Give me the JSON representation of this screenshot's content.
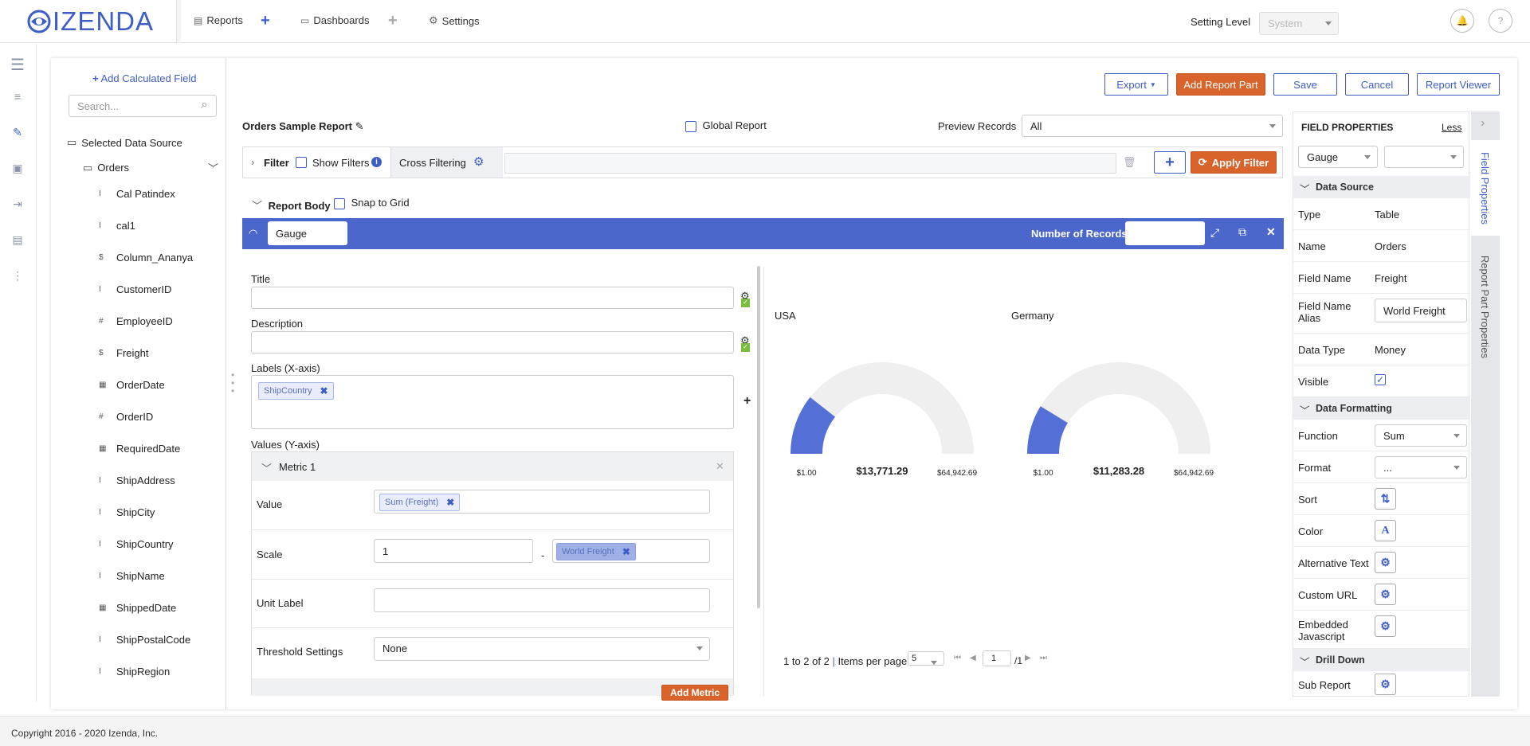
{
  "brand": {
    "logo_text": "IZENDA",
    "brand_color": "#3f5ec4"
  },
  "topnav": {
    "reports": "Reports",
    "dashboards": "Dashboards",
    "settings": "Settings"
  },
  "setting_level": {
    "label": "Setting Level",
    "value": "System"
  },
  "fields": {
    "add_calculated": "Add Calculated Field",
    "search_placeholder": "Search...",
    "selected_source": "Selected Data Source",
    "table": "Orders",
    "items": [
      {
        "name": "Cal Patindex",
        "icon": "text-type-icon",
        "glyph": "I"
      },
      {
        "name": "cal1",
        "icon": "text-type-icon",
        "glyph": "I"
      },
      {
        "name": "Column_Ananya",
        "icon": "money-type-icon",
        "glyph": "$"
      },
      {
        "name": "CustomerID",
        "icon": "text-type-icon",
        "glyph": "I"
      },
      {
        "name": "EmployeeID",
        "icon": "number-type-icon",
        "glyph": "#"
      },
      {
        "name": "Freight",
        "icon": "money-type-icon",
        "glyph": "$"
      },
      {
        "name": "OrderDate",
        "icon": "date-type-icon",
        "glyph": "▦"
      },
      {
        "name": "OrderID",
        "icon": "number-type-icon",
        "glyph": "#"
      },
      {
        "name": "RequiredDate",
        "icon": "date-type-icon",
        "glyph": "▦"
      },
      {
        "name": "ShipAddress",
        "icon": "text-type-icon",
        "glyph": "I"
      },
      {
        "name": "ShipCity",
        "icon": "text-type-icon",
        "glyph": "I"
      },
      {
        "name": "ShipCountry",
        "icon": "text-type-icon",
        "glyph": "I"
      },
      {
        "name": "ShipName",
        "icon": "text-type-icon",
        "glyph": "I"
      },
      {
        "name": "ShippedDate",
        "icon": "date-type-icon",
        "glyph": "▦"
      },
      {
        "name": "ShipPostalCode",
        "icon": "text-type-icon",
        "glyph": "I"
      },
      {
        "name": "ShipRegion",
        "icon": "text-type-icon",
        "glyph": "I"
      }
    ]
  },
  "toolbar": {
    "export": "Export",
    "add_report_part": "Add Report Part",
    "save": "Save",
    "cancel": "Cancel",
    "report_viewer": "Report Viewer"
  },
  "report": {
    "name": "Orders Sample Report",
    "global_report": "Global Report",
    "preview_label": "Preview Records",
    "preview_value": "All"
  },
  "filter": {
    "label": "Filter",
    "show_filters": "Show Filters",
    "cross_filtering": "Cross Filtering",
    "apply": "Apply Filter"
  },
  "report_body": {
    "label": "Report Body",
    "snap": "Snap to Grid"
  },
  "part": {
    "type": "Gauge",
    "num_records_label": "Number of Records"
  },
  "editor": {
    "title_label": "Title",
    "description_label": "Description",
    "labels_label": "Labels (X-axis)",
    "labels_tag": "ShipCountry",
    "values_label": "Values (Y-axis)",
    "metric_name": "Metric 1",
    "value_label": "Value",
    "value_tag": "Sum (Freight)",
    "scale_label": "Scale",
    "scale_min": "1",
    "scale_dash": "-",
    "scale_tag": "World Freight",
    "unit_label": "Unit Label",
    "threshold_label": "Threshold Settings",
    "threshold_value": "None",
    "add_metric": "Add Metric"
  },
  "chart_data": {
    "type": "gauge",
    "gauges": [
      {
        "name": "USA",
        "min_label": "$1.00",
        "value_label": "$13,771.29",
        "max_label": "$64,942.69",
        "min": 1,
        "value": 13771.29,
        "max": 64942.69
      },
      {
        "name": "Germany",
        "min_label": "$1.00",
        "value_label": "$11,283.28",
        "max_label": "$64,942.69",
        "min": 1,
        "value": 11283.28,
        "max": 64942.69
      }
    ],
    "fill_color": "#5470d6",
    "track_color": "#efefef"
  },
  "pager": {
    "summary": "1 to 2 of 2",
    "items_label": "Items per page",
    "per_page": "5",
    "page": "1",
    "of": "/1"
  },
  "props": {
    "header": "FIELD PROPERTIES",
    "less": "Less",
    "chart_type": "Gauge",
    "sec_data_source": "Data Source",
    "type_label": "Type",
    "type_value": "Table",
    "name_label": "Name",
    "name_value": "Orders",
    "field_name_label": "Field Name",
    "field_name_value": "Freight",
    "alias_label": "Field Name Alias",
    "alias_value": "World Freight",
    "data_type_label": "Data Type",
    "data_type_value": "Money",
    "visible_label": "Visible",
    "sec_formatting": "Data Formatting",
    "function_label": "Function",
    "function_value": "Sum",
    "format_label": "Format",
    "format_value": "...",
    "sort_label": "Sort",
    "color_label": "Color",
    "alt_text_label": "Alternative Text",
    "custom_url_label": "Custom URL",
    "embedded_js_label": "Embedded Javascript",
    "sec_drill": "Drill Down",
    "sub_report_label": "Sub Report"
  },
  "side_tabs": {
    "field_properties": "Field Properties",
    "report_part_properties": "Report Part Properties"
  },
  "footer": "Copyright 2016 - 2020 Izenda, Inc."
}
